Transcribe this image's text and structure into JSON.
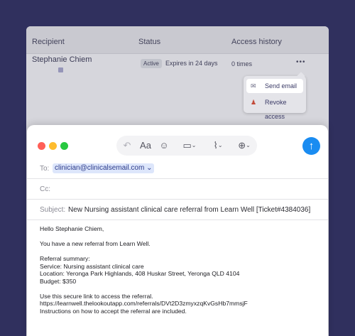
{
  "access_table": {
    "headers": {
      "recipient": "Recipient",
      "status": "Status",
      "access_history": "Access history"
    },
    "row": {
      "name": "Stephanie Chiem",
      "status": "Active",
      "expires": "Expires in 24 days",
      "access_count": "0 times",
      "menu_label": "•••"
    },
    "menu": {
      "send_email": "Send email",
      "revoke_access": "Revoke access",
      "send_icon": "envelope-icon",
      "revoke_icon": "user-remove-icon"
    }
  },
  "compose": {
    "to_label": "To:",
    "to_value": "clinician@clinicalsemail.com",
    "cc_label": "Cc:",
    "cc_value": "",
    "subject_label": "Subject:",
    "subject_value": "New Nursing assistant clinical care referral from Learn Well [Ticket#4384036]",
    "format_label": "Aa",
    "send_color": "#1a8cf1",
    "toolbar_icons": [
      "reply-icon",
      "format-text-icon",
      "emoji-icon",
      "table-icon",
      "attachment-icon",
      "markup-icon"
    ],
    "body": {
      "greeting": "Hello Stephanie Chiem,",
      "intro": "You have a new referral from Learn Well.",
      "summary_title": "Referral summary:",
      "service": "Service: Nursing assistant clinical care",
      "location": "Location: Yeronga Park Highlands, 408 Huskar Street, Yeronga QLD 4104",
      "budget": "Budget: $350",
      "link_intro": "Use this secure link to access the referral.",
      "link": "https://learnwell.thelookoutapp.com/referrals/DVt2D3zmyxzqKvGsHb7mmsjF",
      "instructions": "Instructions on how to accept the referral are included."
    }
  }
}
